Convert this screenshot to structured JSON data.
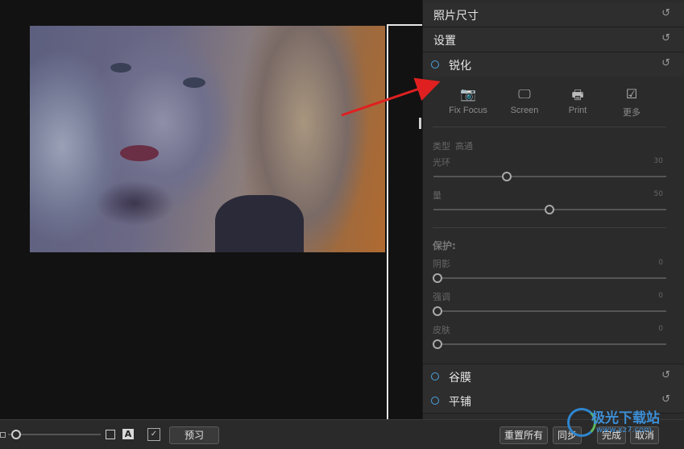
{
  "panel": {
    "sections": {
      "photo_size": {
        "title": "照片尺寸",
        "reset_icon": "↺"
      },
      "settings": {
        "title": "设置",
        "reset_icon": "↺"
      },
      "sharpen": {
        "title": "锐化",
        "reset_icon": "↺"
      },
      "grain": {
        "title": "谷膜",
        "reset_icon": "↺"
      },
      "tile": {
        "title": "平铺",
        "reset_icon": "↺"
      }
    },
    "presets": [
      {
        "icon": "camera-icon",
        "glyph": "📷",
        "label": "Fix Focus"
      },
      {
        "icon": "monitor-icon",
        "glyph": "🖵",
        "label": "Screen"
      },
      {
        "icon": "printer-icon",
        "glyph": "🖶",
        "label": "Print"
      },
      {
        "icon": "more-icon",
        "glyph": "☑",
        "label": "更多"
      }
    ],
    "type_label": "类型",
    "type_value": "高通",
    "sliders": {
      "halo": {
        "label": "光环",
        "value": "30",
        "level": 0.31
      },
      "amount": {
        "label": "量",
        "value": "50",
        "level": 0.5
      }
    },
    "protect_label": "保护:",
    "protect_sliders": {
      "shadows": {
        "label": "阴影",
        "value": "0",
        "level": 0
      },
      "highlights": {
        "label": "强调",
        "value": "0",
        "level": 0
      },
      "skin": {
        "label": "皮肤",
        "value": "0",
        "level": 0
      }
    }
  },
  "toolbar": {
    "a_icon_label": "A",
    "check_icon_glyph": "✓",
    "preview_label": "预习",
    "reset_all_label": "重置所有",
    "sync_label": "同步",
    "done_label": "完成",
    "cancel_label": "取消",
    "zoom_level": 0.05
  },
  "watermark": {
    "text": "极光下载站",
    "url": "www.xz7.com"
  },
  "colors": {
    "accent": "#4aa3df",
    "arrow": "#e02020",
    "panel_bg": "#2b2b2b"
  }
}
